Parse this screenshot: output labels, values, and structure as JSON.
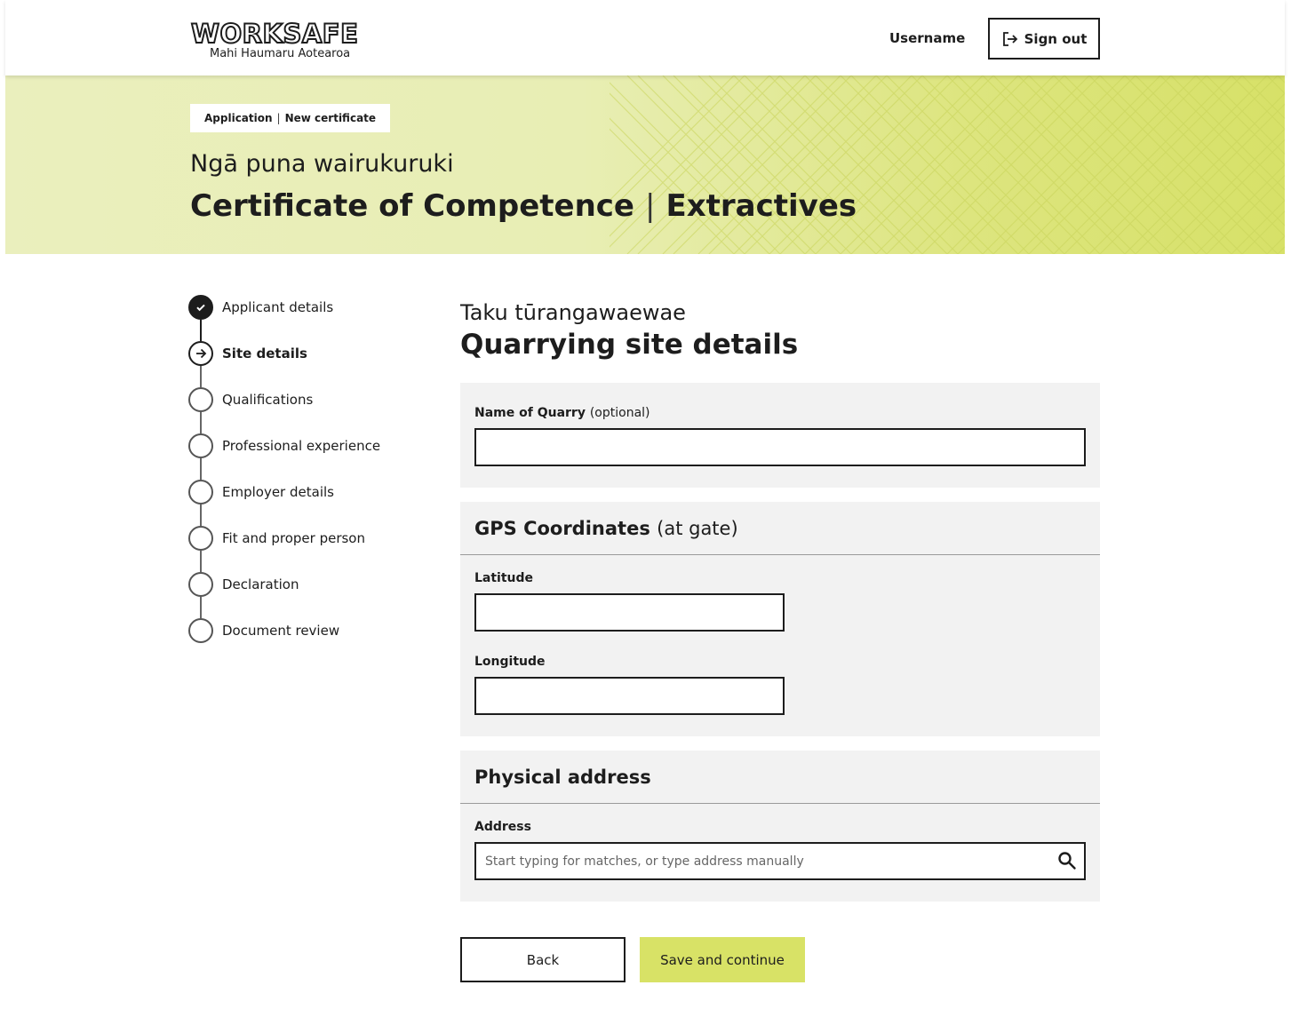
{
  "header": {
    "logo_text": "WORKSAFE",
    "logo_subtext": "Mahi Haumaru Aotearoa",
    "username": "Username",
    "sign_out_label": "Sign out"
  },
  "hero": {
    "breadcrumb": [
      "Application",
      "New certificate"
    ],
    "subtitle": "Ngā puna wairukuruki",
    "title_main": "Certificate of Competence",
    "title_secondary": "Extractives",
    "colors": {
      "start": "#eaefbd",
      "end": "#d7e168"
    }
  },
  "steps": [
    {
      "label": "Applicant details",
      "state": "complete"
    },
    {
      "label": "Site details",
      "state": "current"
    },
    {
      "label": "Qualifications",
      "state": "pending"
    },
    {
      "label": "Professional experience",
      "state": "pending"
    },
    {
      "label": "Employer details",
      "state": "pending"
    },
    {
      "label": "Fit and proper person",
      "state": "pending"
    },
    {
      "label": "Declaration",
      "state": "pending"
    },
    {
      "label": "Document review",
      "state": "pending"
    }
  ],
  "main": {
    "subtitle": "Taku  tūrangawaewae",
    "title": "Quarrying site details",
    "quarry": {
      "label": "Name of Quarry",
      "optional": "(optional)",
      "value": ""
    },
    "gps": {
      "heading": "GPS Coordinates",
      "heading_note": "(at gate)",
      "latitude_label": "Latitude",
      "latitude_value": "",
      "longitude_label": "Longitude",
      "longitude_value": ""
    },
    "address": {
      "heading": "Physical address",
      "label": "Address",
      "placeholder": "Start typing for matches, or type address manually",
      "value": ""
    }
  },
  "actions": {
    "back_label": "Back",
    "save_label": "Save and continue",
    "save_color": "#d8e266"
  },
  "icons": {
    "sign_out": "sign-out-icon",
    "complete_step": "check-icon",
    "current_step": "arrow-right-icon",
    "search": "search-icon"
  }
}
